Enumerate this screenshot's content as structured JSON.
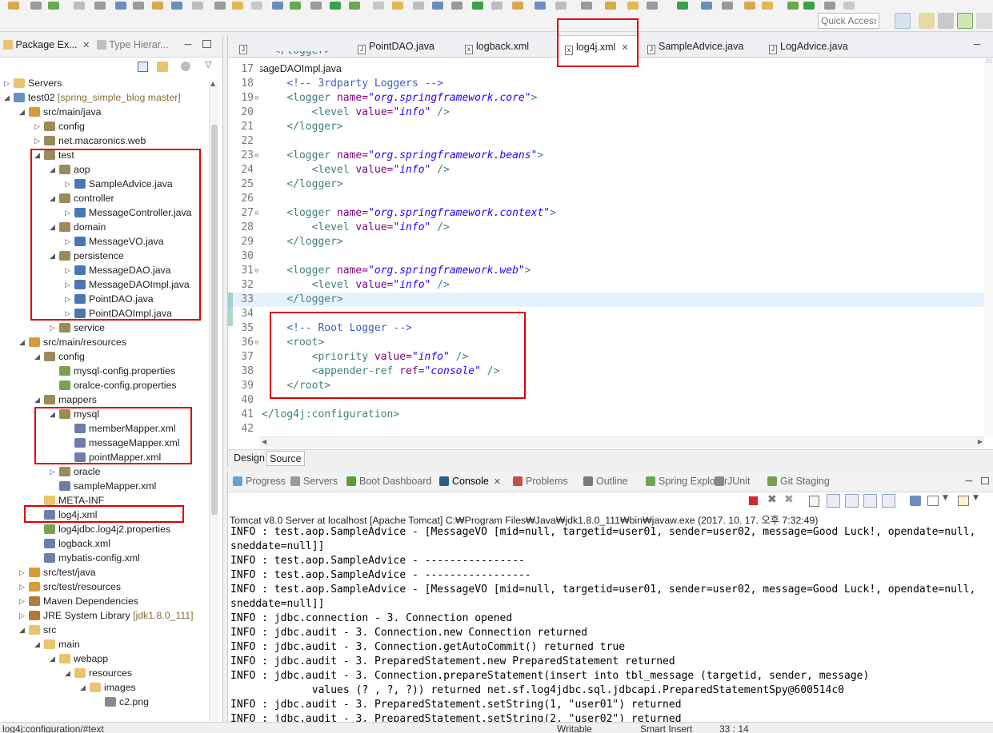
{
  "toolbar": {
    "quick_access_placeholder": "Quick Access"
  },
  "package_explorer": {
    "tabs": [
      {
        "label": "Package Ex...",
        "closable": true,
        "active": true
      },
      {
        "label": "Type Hierar...",
        "closable": false,
        "active": false
      }
    ],
    "tree": [
      {
        "label": "Servers",
        "deco": "",
        "level": 0,
        "twisty": "collapsed",
        "icon": "folder-icon"
      },
      {
        "label": "test02",
        "deco": " [spring_simple_blog master]",
        "level": 0,
        "twisty": "expanded",
        "icon": "maven-project-icon"
      },
      {
        "label": "src/main/java",
        "deco": "",
        "level": 1,
        "twisty": "expanded",
        "icon": "source-folder-icon"
      },
      {
        "label": "config",
        "deco": "",
        "level": 2,
        "twisty": "collapsed",
        "icon": "package-icon"
      },
      {
        "label": "net.macaronics.web",
        "deco": "",
        "level": 2,
        "twisty": "collapsed",
        "icon": "package-icon"
      },
      {
        "label": "test",
        "deco": "",
        "level": 2,
        "twisty": "expanded",
        "icon": "package-icon"
      },
      {
        "label": "aop",
        "deco": "",
        "level": 3,
        "twisty": "expanded",
        "icon": "package-icon"
      },
      {
        "label": "SampleAdvice.java",
        "deco": "",
        "level": 4,
        "twisty": "collapsed",
        "icon": "java-file-icon"
      },
      {
        "label": "controller",
        "deco": "",
        "level": 3,
        "twisty": "expanded",
        "icon": "package-icon"
      },
      {
        "label": "MessageController.java",
        "deco": "",
        "level": 4,
        "twisty": "collapsed",
        "icon": "java-file-icon"
      },
      {
        "label": "domain",
        "deco": "",
        "level": 3,
        "twisty": "expanded",
        "icon": "package-icon"
      },
      {
        "label": "MessageVO.java",
        "deco": "",
        "level": 4,
        "twisty": "collapsed",
        "icon": "java-file-icon"
      },
      {
        "label": "persistence",
        "deco": "",
        "level": 3,
        "twisty": "expanded",
        "icon": "package-icon"
      },
      {
        "label": "MessageDAO.java",
        "deco": "",
        "level": 4,
        "twisty": "collapsed",
        "icon": "java-file-icon"
      },
      {
        "label": "MessageDAOImpl.java",
        "deco": "",
        "level": 4,
        "twisty": "collapsed",
        "icon": "java-file-icon"
      },
      {
        "label": "PointDAO.java",
        "deco": "",
        "level": 4,
        "twisty": "collapsed",
        "icon": "java-file-icon"
      },
      {
        "label": "PointDAOImpl.java",
        "deco": "",
        "level": 4,
        "twisty": "collapsed",
        "icon": "java-file-icon"
      },
      {
        "label": "service",
        "deco": "",
        "level": 3,
        "twisty": "collapsed",
        "icon": "package-icon"
      },
      {
        "label": "src/main/resources",
        "deco": "",
        "level": 1,
        "twisty": "expanded",
        "icon": "source-folder-icon"
      },
      {
        "label": "config",
        "deco": "",
        "level": 2,
        "twisty": "expanded",
        "icon": "package-icon"
      },
      {
        "label": "mysql-config.properties",
        "deco": "",
        "level": 3,
        "twisty": "none",
        "icon": "properties-file-icon"
      },
      {
        "label": "oralce-config.properties",
        "deco": "",
        "level": 3,
        "twisty": "none",
        "icon": "properties-file-icon"
      },
      {
        "label": "mappers",
        "deco": "",
        "level": 2,
        "twisty": "expanded",
        "icon": "package-icon"
      },
      {
        "label": "mysql",
        "deco": "",
        "level": 3,
        "twisty": "expanded",
        "icon": "package-icon"
      },
      {
        "label": "memberMapper.xml",
        "deco": "",
        "level": 4,
        "twisty": "none",
        "icon": "xml-file-icon"
      },
      {
        "label": "messageMapper.xml",
        "deco": "",
        "level": 4,
        "twisty": "none",
        "icon": "xml-file-icon"
      },
      {
        "label": "pointMapper.xml",
        "deco": "",
        "level": 4,
        "twisty": "none",
        "icon": "xml-file-icon"
      },
      {
        "label": "oracle",
        "deco": "",
        "level": 3,
        "twisty": "collapsed",
        "icon": "package-icon"
      },
      {
        "label": "sampleMapper.xml",
        "deco": "",
        "level": 3,
        "twisty": "none",
        "icon": "xml-file-icon"
      },
      {
        "label": "META-INF",
        "deco": "",
        "level": 2,
        "twisty": "none",
        "icon": "folder-icon"
      },
      {
        "label": "log4j.xml",
        "deco": "",
        "level": 2,
        "twisty": "none",
        "icon": "xml-file-icon"
      },
      {
        "label": "log4jdbc.log4j2.properties",
        "deco": "",
        "level": 2,
        "twisty": "none",
        "icon": "properties-file-icon"
      },
      {
        "label": "logback.xml",
        "deco": "",
        "level": 2,
        "twisty": "none",
        "icon": "xml-file-icon"
      },
      {
        "label": "mybatis-config.xml",
        "deco": "",
        "level": 2,
        "twisty": "none",
        "icon": "xml-file-icon"
      },
      {
        "label": "src/test/java",
        "deco": "",
        "level": 1,
        "twisty": "collapsed",
        "icon": "source-folder-icon"
      },
      {
        "label": "src/test/resources",
        "deco": "",
        "level": 1,
        "twisty": "collapsed",
        "icon": "source-folder-icon"
      },
      {
        "label": "Maven Dependencies",
        "deco": "",
        "level": 1,
        "twisty": "collapsed",
        "icon": "library-icon"
      },
      {
        "label": "JRE System Library",
        "deco": " [jdk1.8.0_111]",
        "level": 1,
        "twisty": "collapsed",
        "icon": "library-icon"
      },
      {
        "label": "src",
        "deco": "",
        "level": 1,
        "twisty": "expanded",
        "icon": "folder-icon"
      },
      {
        "label": "main",
        "deco": "",
        "level": 2,
        "twisty": "expanded",
        "icon": "folder-icon"
      },
      {
        "label": "webapp",
        "deco": "",
        "level": 3,
        "twisty": "expanded",
        "icon": "folder-icon"
      },
      {
        "label": "resources",
        "deco": "",
        "level": 4,
        "twisty": "expanded",
        "icon": "folder-icon"
      },
      {
        "label": "images",
        "deco": "",
        "level": 5,
        "twisty": "expanded",
        "icon": "folder-icon"
      },
      {
        "label": "c2.png",
        "deco": "",
        "level": 6,
        "twisty": "none",
        "icon": "image-file-icon"
      }
    ]
  },
  "editor": {
    "tabs": [
      {
        "label": "MessageDAOImpl.java",
        "active": false
      },
      {
        "label": "PointDAO.java",
        "active": false
      },
      {
        "label": "logback.xml",
        "active": false
      },
      {
        "label": "log4j.xml",
        "active": true
      },
      {
        "label": "SampleAdvice.java",
        "active": false
      },
      {
        "label": "LogAdvice.java",
        "active": false
      }
    ],
    "partial_line": "  </logger>",
    "lines": [
      {
        "n": "17",
        "fold": "",
        "parts": []
      },
      {
        "n": "18",
        "fold": "",
        "parts": [
          [
            "plain",
            "    "
          ],
          [
            "com",
            "<!-- 3rdparty Loggers -->"
          ]
        ]
      },
      {
        "n": "19",
        "fold": "⊖",
        "parts": [
          [
            "plain",
            "    "
          ],
          [
            "tag",
            "<logger "
          ],
          [
            "attr",
            "name="
          ],
          [
            "val",
            "\"org.springframework.core\""
          ],
          [
            "tag",
            ">"
          ]
        ]
      },
      {
        "n": "20",
        "fold": "",
        "parts": [
          [
            "plain",
            "        "
          ],
          [
            "tag",
            "<level "
          ],
          [
            "attr",
            "value="
          ],
          [
            "val",
            "\"info\""
          ],
          [
            "tag",
            " />"
          ]
        ]
      },
      {
        "n": "21",
        "fold": "",
        "parts": [
          [
            "plain",
            "    "
          ],
          [
            "tag",
            "</logger>"
          ]
        ]
      },
      {
        "n": "22",
        "fold": "",
        "parts": []
      },
      {
        "n": "23",
        "fold": "⊖",
        "parts": [
          [
            "plain",
            "    "
          ],
          [
            "tag",
            "<logger "
          ],
          [
            "attr",
            "name="
          ],
          [
            "val",
            "\"org.springframework.beans\""
          ],
          [
            "tag",
            ">"
          ]
        ]
      },
      {
        "n": "24",
        "fold": "",
        "parts": [
          [
            "plain",
            "        "
          ],
          [
            "tag",
            "<level "
          ],
          [
            "attr",
            "value="
          ],
          [
            "val",
            "\"info\""
          ],
          [
            "tag",
            " />"
          ]
        ]
      },
      {
        "n": "25",
        "fold": "",
        "parts": [
          [
            "plain",
            "    "
          ],
          [
            "tag",
            "</logger>"
          ]
        ]
      },
      {
        "n": "26",
        "fold": "",
        "parts": []
      },
      {
        "n": "27",
        "fold": "⊖",
        "parts": [
          [
            "plain",
            "    "
          ],
          [
            "tag",
            "<logger "
          ],
          [
            "attr",
            "name="
          ],
          [
            "val",
            "\"org.springframework.context\""
          ],
          [
            "tag",
            ">"
          ]
        ]
      },
      {
        "n": "28",
        "fold": "",
        "parts": [
          [
            "plain",
            "        "
          ],
          [
            "tag",
            "<level "
          ],
          [
            "attr",
            "value="
          ],
          [
            "val",
            "\"info\""
          ],
          [
            "tag",
            " />"
          ]
        ]
      },
      {
        "n": "29",
        "fold": "",
        "parts": [
          [
            "plain",
            "    "
          ],
          [
            "tag",
            "</logger>"
          ]
        ]
      },
      {
        "n": "30",
        "fold": "",
        "parts": []
      },
      {
        "n": "31",
        "fold": "⊖",
        "parts": [
          [
            "plain",
            "    "
          ],
          [
            "tag",
            "<logger "
          ],
          [
            "attr",
            "name="
          ],
          [
            "val",
            "\"org.springframework.web\""
          ],
          [
            "tag",
            ">"
          ]
        ]
      },
      {
        "n": "32",
        "fold": "",
        "parts": [
          [
            "plain",
            "        "
          ],
          [
            "tag",
            "<level "
          ],
          [
            "attr",
            "value="
          ],
          [
            "val",
            "\"info\""
          ],
          [
            "tag",
            " />"
          ]
        ]
      },
      {
        "n": "33",
        "fold": "",
        "parts": [
          [
            "plain",
            "    "
          ],
          [
            "tag",
            "</logger>"
          ]
        ],
        "current": true
      },
      {
        "n": "34",
        "fold": "",
        "parts": []
      },
      {
        "n": "35",
        "fold": "",
        "parts": [
          [
            "plain",
            "    "
          ],
          [
            "com",
            "<!-- Root Logger -->"
          ]
        ]
      },
      {
        "n": "36",
        "fold": "⊖",
        "parts": [
          [
            "plain",
            "    "
          ],
          [
            "tag",
            "<root>"
          ]
        ]
      },
      {
        "n": "37",
        "fold": "",
        "parts": [
          [
            "plain",
            "        "
          ],
          [
            "tag",
            "<priority "
          ],
          [
            "attr",
            "value="
          ],
          [
            "val",
            "\"info\""
          ],
          [
            "tag",
            " />"
          ]
        ]
      },
      {
        "n": "38",
        "fold": "",
        "parts": [
          [
            "plain",
            "        "
          ],
          [
            "tag",
            "<appender-ref "
          ],
          [
            "attr",
            "ref="
          ],
          [
            "val",
            "\"console\""
          ],
          [
            "tag",
            " />"
          ]
        ]
      },
      {
        "n": "39",
        "fold": "",
        "parts": [
          [
            "plain",
            "    "
          ],
          [
            "tag",
            "</root>"
          ]
        ]
      },
      {
        "n": "40",
        "fold": "",
        "parts": []
      },
      {
        "n": "41",
        "fold": "",
        "parts": [
          [
            "tag",
            "</log4j:configuration>"
          ]
        ]
      },
      {
        "n": "42",
        "fold": "",
        "parts": []
      }
    ],
    "bottom_tabs": [
      {
        "label": "Design",
        "active": false
      },
      {
        "label": "Source",
        "active": true
      }
    ]
  },
  "console": {
    "tabs": [
      {
        "label": "Progress",
        "active": false,
        "closable": false,
        "color": "#6a9fd4"
      },
      {
        "label": "Servers",
        "active": false,
        "closable": false,
        "color": "#9a9a9a"
      },
      {
        "label": "Boot Dashboard",
        "active": false,
        "closable": false,
        "color": "#5aa02c"
      },
      {
        "label": "Console",
        "active": true,
        "closable": true,
        "color": "#2b5f8a"
      },
      {
        "label": "Problems",
        "active": false,
        "closable": false,
        "color": "#c05050"
      },
      {
        "label": "Outline",
        "active": false,
        "closable": false,
        "color": "#7a7a7a"
      },
      {
        "label": "Spring Explorer",
        "active": false,
        "closable": false,
        "color": "#6aa84f"
      },
      {
        "label": "JUnit",
        "active": false,
        "closable": false,
        "color": "#8a8a8a"
      },
      {
        "label": "Git Staging",
        "active": false,
        "closable": false,
        "color": "#7a9a5a"
      }
    ],
    "description": "Tomcat v8.0 Server at localhost [Apache Tomcat] C:₩Program Files₩Java₩jdk1.8.0_111₩bin₩javaw.exe (2017. 10. 17. 오후 7:32:49)",
    "lines": [
      "INFO : test.aop.SampleAdvice - [MessageVO [mid=null, targetid=user01, sender=user02, message=Good Luck!, opendate=null,",
      "sneddate=null]]",
      "INFO : test.aop.SampleAdvice - ----------------",
      "INFO : test.aop.SampleAdvice - -----------------",
      "INFO : test.aop.SampleAdvice - [MessageVO [mid=null, targetid=user01, sender=user02, message=Good Luck!, opendate=null,",
      "sneddate=null]]",
      "INFO : jdbc.connection - 3. Connection opened",
      "INFO : jdbc.audit - 3. Connection.new Connection returned",
      "INFO : jdbc.audit - 3. Connection.getAutoCommit() returned true",
      "INFO : jdbc.audit - 3. PreparedStatement.new PreparedStatement returned",
      "INFO : jdbc.audit - 3. Connection.prepareStatement(insert into tbl_message (targetid, sender, message)",
      "             values (? , ?, ?)) returned net.sf.log4jdbc.sql.jdbcapi.PreparedStatementSpy@600514c0",
      "INFO : jdbc.audit - 3. PreparedStatement.setString(1, \"user01\") returned",
      "INFO : jdbc.audit - 3. PreparedStatement.setString(2, \"user02\") returned"
    ]
  },
  "statusbar": {
    "path": "log4j:configuration/#text",
    "mode": "Writable",
    "insert": "Smart Insert",
    "position": "33 : 14"
  },
  "colors": {
    "annotation": "#e00000",
    "selection_line": "#e8f2fe"
  }
}
